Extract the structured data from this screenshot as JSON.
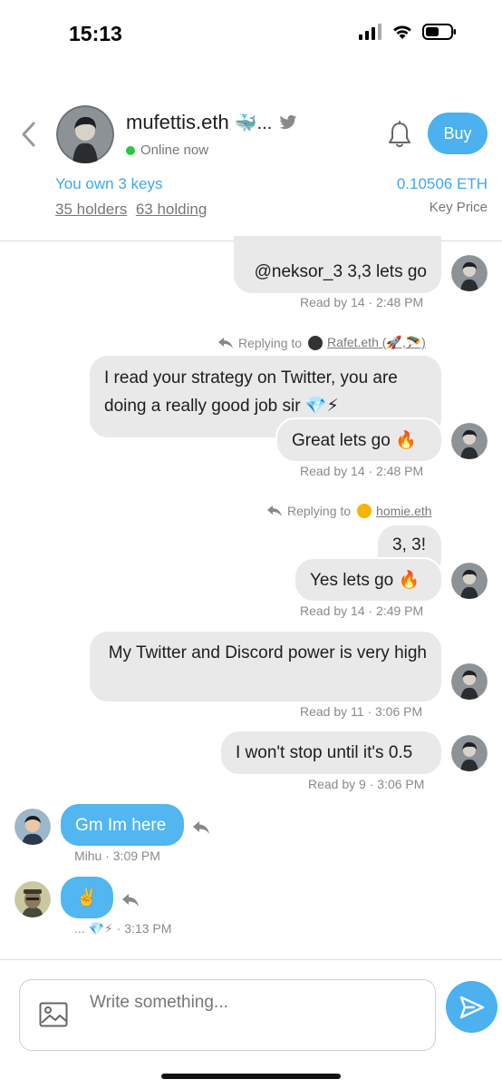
{
  "status_bar": {
    "time": "15:13"
  },
  "header": {
    "name": "mufettis.eth",
    "name_suffix": "🐳...",
    "status": "Online now",
    "buy_label": "Buy",
    "own_keys": "You own 3 keys",
    "holders": "35 holders",
    "holding": "63 holding",
    "price": "0.10506 ETH",
    "price_label": "Key Price"
  },
  "messages": {
    "m1": {
      "text": "@neksor_3 3,3 lets go",
      "meta": "Read by 14 · 2:48 PM"
    },
    "m2": {
      "reply_prefix": "Replying to",
      "reply_handle": "Rafet.eth (🚀,🪂)",
      "text_top": "I read your strategy on Twitter, you are doing a really good job sir 💎⚡",
      "text_bottom": "Great lets go 🔥",
      "meta": "Read by 14 · 2:48 PM"
    },
    "m3": {
      "reply_prefix": "Replying to",
      "reply_handle": "homie.eth",
      "text_top": "3, 3!",
      "text_bottom": "Yes lets go 🔥",
      "meta": "Read by 14 · 2:49 PM"
    },
    "m4": {
      "text": "My Twitter and Discord power is very high",
      "meta": "Read by 11 · 3:06 PM"
    },
    "m5": {
      "text": "I won't stop until it's 0.5",
      "meta": "Read by 9 · 3:06 PM"
    },
    "m6": {
      "text": "Gm Im here",
      "meta": "Mihu · 3:09 PM"
    },
    "m7": {
      "text": "✌️",
      "meta": "... 💎⚡ · 3:13 PM"
    }
  },
  "composer": {
    "placeholder": "Write something..."
  },
  "colors": {
    "accent": "#4bb1ef",
    "bubble_gray": "#e9e9e9",
    "online": "#27c93f"
  },
  "icons": [
    "back-chevron-icon",
    "whale-icon",
    "twitter-icon",
    "bell-icon",
    "reply-icon",
    "image-icon",
    "send-icon",
    "signal-icon",
    "wifi-icon",
    "battery-icon"
  ]
}
